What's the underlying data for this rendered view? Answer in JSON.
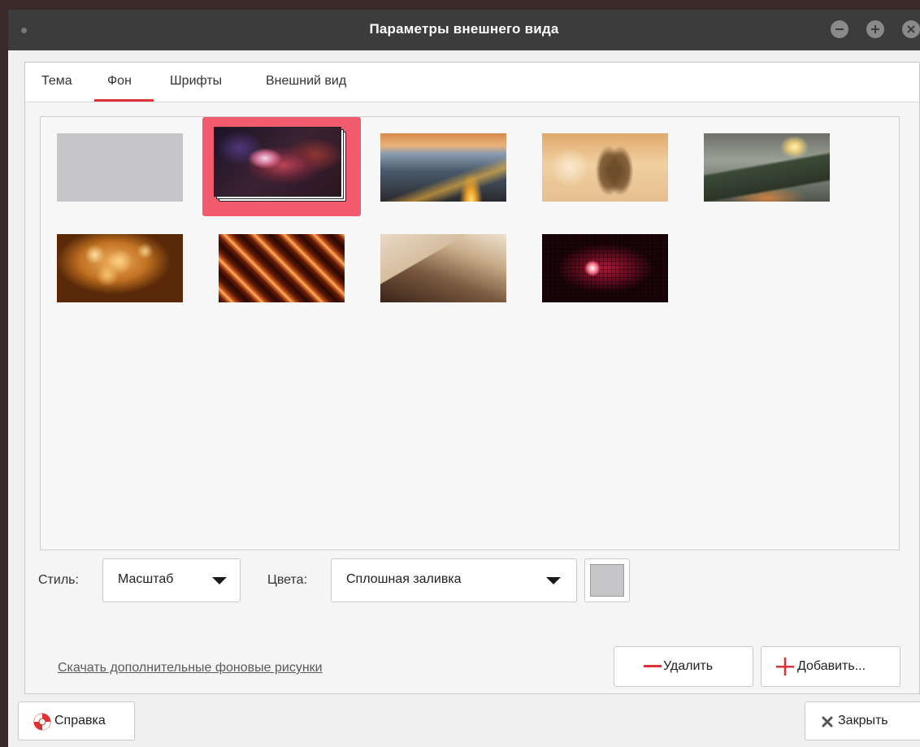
{
  "window": {
    "title": "Параметры внешнего вида"
  },
  "tabs": [
    {
      "label": "Тема"
    },
    {
      "label": "Фон"
    },
    {
      "label": "Шрифты"
    },
    {
      "label": "Внешний вид"
    }
  ],
  "active_tab": "Фон",
  "wallpapers": [
    {
      "name": "blank-gray",
      "selected": false
    },
    {
      "name": "orion-nebula",
      "selected": true
    },
    {
      "name": "road-lights",
      "selected": false
    },
    {
      "name": "monument-church",
      "selected": false
    },
    {
      "name": "armored-train",
      "selected": false
    },
    {
      "name": "golden-bokeh",
      "selected": false
    },
    {
      "name": "orange-streaks",
      "selected": false
    },
    {
      "name": "beige-abstract",
      "selected": false
    },
    {
      "name": "red-pixels",
      "selected": false
    }
  ],
  "style": {
    "label": "Стиль:",
    "value": "Масштаб"
  },
  "colors": {
    "label": "Цвета:",
    "value": "Сплошная заливка",
    "swatch_color": "#c6c5c8"
  },
  "download_link": "Скачать дополнительные фоновые рисунки",
  "buttons": {
    "remove": "Удалить",
    "add": "Добавить...",
    "help": "Справка",
    "close": "Закрыть"
  },
  "accent_color": "#e0303a"
}
